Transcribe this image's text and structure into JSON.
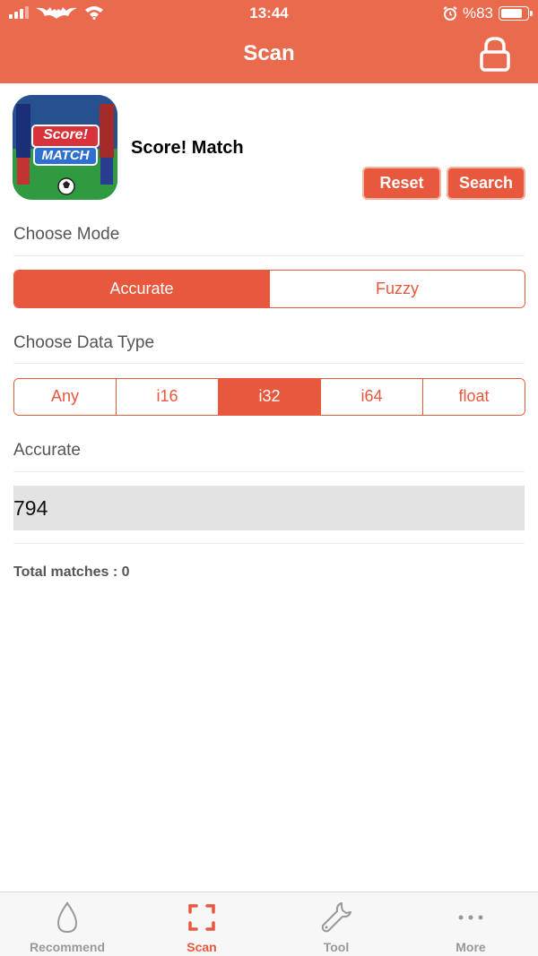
{
  "status_bar": {
    "time": "13:44",
    "battery": "%83",
    "battery_level": 0.83
  },
  "nav": {
    "title": "Scan",
    "lock_icon": "lock-icon"
  },
  "app": {
    "name": "Score! Match",
    "icon_text_top": "Score!",
    "icon_text_bottom": "MATCH"
  },
  "actions": {
    "reset_label": "Reset",
    "search_label": "Search"
  },
  "mode": {
    "label": "Choose Mode",
    "options": [
      "Accurate",
      "Fuzzy"
    ],
    "selected": "Accurate"
  },
  "data_type": {
    "label": "Choose Data Type",
    "options": [
      "Any",
      "i16",
      "i32",
      "i64",
      "float"
    ],
    "selected": "i32"
  },
  "search_value": {
    "label": "Accurate",
    "value": "794"
  },
  "results": {
    "total_text": "Total matches : 0"
  },
  "colors": {
    "accent": "#e8583c",
    "header": "#ea6a4d"
  },
  "tabbar": {
    "tabs": [
      {
        "label": "Recommend",
        "icon": "drop-icon"
      },
      {
        "label": "Scan",
        "icon": "scan-frame-icon"
      },
      {
        "label": "Tool",
        "icon": "wrench-icon"
      },
      {
        "label": "More",
        "icon": "more-dots-icon"
      }
    ],
    "active": "Scan"
  }
}
